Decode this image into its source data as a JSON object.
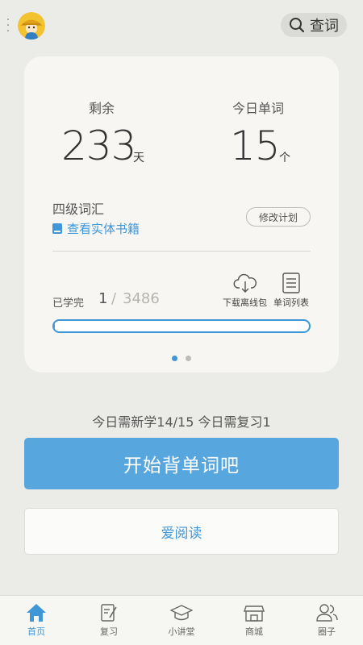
{
  "header": {
    "search_label": "查词"
  },
  "plan": {
    "remaining_label": "剩余",
    "remaining_value": "233",
    "remaining_unit": "天",
    "today_label": "今日单词",
    "today_value": "15",
    "today_unit": "个",
    "book_name": "四级词汇",
    "book_link": "查看实体书籍",
    "edit_plan_label": "修改计划",
    "learned_label": "已学完",
    "learned_current": "1",
    "learned_separator": "/",
    "learned_total": "3486",
    "progress_fraction": 0.0003,
    "download_label": "下载离线包",
    "wordlist_label": "单词列表",
    "pages": 2,
    "active_page": 1
  },
  "summary": {
    "text": "今日需新学14/15  今日需复习1"
  },
  "actions": {
    "start_label": "开始背单词吧",
    "read_label": "爱阅读"
  },
  "tabs": [
    {
      "label": "首页",
      "icon": "home-icon",
      "active": true
    },
    {
      "label": "复习",
      "icon": "review-icon",
      "active": false
    },
    {
      "label": "小讲堂",
      "icon": "mortarboard-icon",
      "active": false
    },
    {
      "label": "商城",
      "icon": "store-icon",
      "active": false
    },
    {
      "label": "圈子",
      "icon": "people-icon",
      "active": false
    }
  ],
  "colors": {
    "accent": "#3f97d8",
    "button": "#58a6de",
    "background": "#ebebe8",
    "card": "#f7f6f2"
  }
}
